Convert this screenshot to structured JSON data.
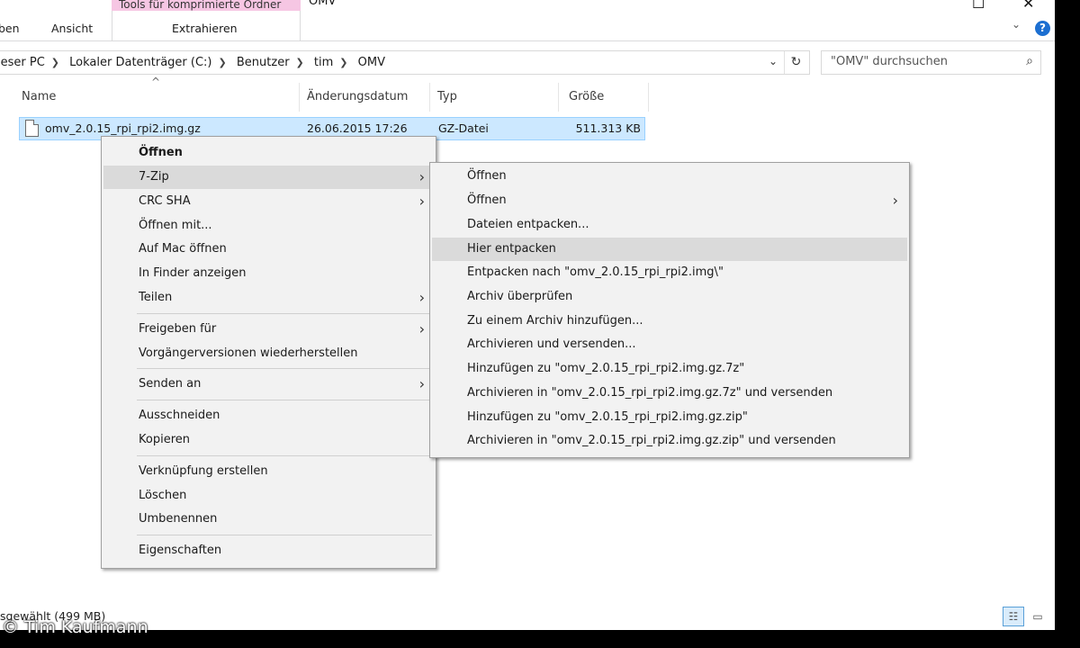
{
  "ribbon": {
    "tab_share": "ben",
    "tab_view": "Ansicht",
    "context_group_title": "Tools für komprimierte Ordner",
    "context_tab": "Extrahieren",
    "window_title": "OMV"
  },
  "address": {
    "crumbs": [
      "ieser PC",
      "Lokaler Datenträger (C:)",
      "Benutzer",
      "tim",
      "OMV"
    ]
  },
  "search": {
    "placeholder": "\"OMV\" durchsuchen"
  },
  "columns": {
    "name": "Name",
    "date": "Änderungsdatum",
    "type": "Typ",
    "size": "Größe"
  },
  "file": {
    "name": "omv_2.0.15_rpi_rpi2.img.gz",
    "date": "26.06.2015 17:26",
    "type": "GZ-Datei",
    "size": "511.313 KB"
  },
  "context_menu": {
    "items": [
      {
        "label": "Öffnen"
      },
      {
        "label": "7-Zip"
      },
      {
        "label": "CRC SHA"
      },
      {
        "label": "Öffnen mit..."
      },
      {
        "label": "Auf Mac öffnen"
      },
      {
        "label": "In Finder anzeigen"
      },
      {
        "label": "Teilen"
      },
      {
        "label": "Freigeben für"
      },
      {
        "label": "Vorgängerversionen wiederherstellen"
      },
      {
        "label": "Senden an"
      },
      {
        "label": "Ausschneiden"
      },
      {
        "label": "Kopieren"
      },
      {
        "label": "Verknüpfung erstellen"
      },
      {
        "label": "Löschen"
      },
      {
        "label": "Umbenennen"
      },
      {
        "label": "Eigenschaften"
      }
    ]
  },
  "submenu_7zip": {
    "items": [
      {
        "label": "Öffnen"
      },
      {
        "label": "Öffnen"
      },
      {
        "label": "Dateien entpacken..."
      },
      {
        "label": "Hier entpacken"
      },
      {
        "label": "Entpacken nach \"omv_2.0.15_rpi_rpi2.img\\\""
      },
      {
        "label": "Archiv überprüfen"
      },
      {
        "label": "Zu einem Archiv hinzufügen..."
      },
      {
        "label": "Archivieren und versenden..."
      },
      {
        "label": "Hinzufügen zu \"omv_2.0.15_rpi_rpi2.img.gz.7z\""
      },
      {
        "label": "Archivieren in \"omv_2.0.15_rpi_rpi2.img.gz.7z\" und versenden"
      },
      {
        "label": "Hinzufügen zu \"omv_2.0.15_rpi_rpi2.img.gz.zip\""
      },
      {
        "label": "Archivieren in \"omv_2.0.15_rpi_rpi2.img.gz.zip\" und versenden"
      }
    ]
  },
  "status": {
    "text": "sgewählt (499 MB)"
  },
  "watermark": "© Tim Kaufmann",
  "colors": {
    "selection": "#cce8ff",
    "menu_bg": "#f2f2f2",
    "menu_highlight": "#dadada",
    "context_tab_accent": "#f6c6e3",
    "help_blue": "#1c6fd1"
  }
}
